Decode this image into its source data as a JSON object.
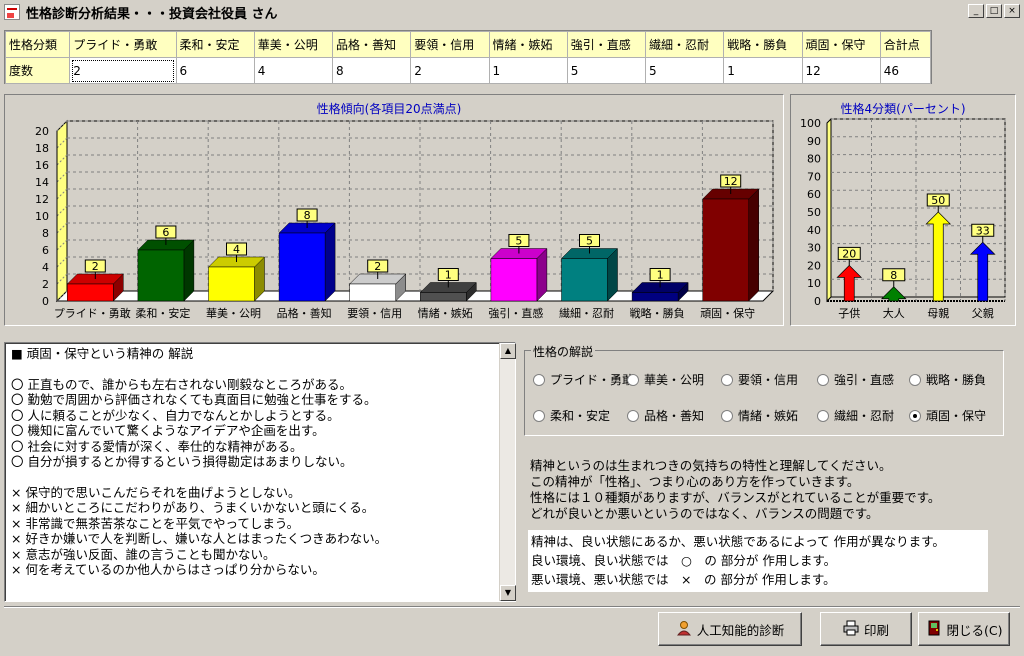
{
  "window": {
    "title": "性格診断分析結果・・・投資会社役員 さん",
    "minimize": "_",
    "maximize": "□",
    "close": "×"
  },
  "table": {
    "row_header": "性格分類",
    "headers": [
      "プライド・勇敢",
      "柔和・安定",
      "華美・公明",
      "品格・善知",
      "要領・信用",
      "情緒・嫉妬",
      "強引・直感",
      "繊細・忍耐",
      "戦略・勝負",
      "頑固・保守",
      "合計点"
    ],
    "value_label": "度数",
    "values": [
      "2",
      "6",
      "4",
      "8",
      "2",
      "1",
      "5",
      "5",
      "1",
      "12",
      "46"
    ]
  },
  "chart_data": [
    {
      "type": "bar",
      "title": "性格傾向(各項目20点満点)",
      "categories": [
        "プライド・勇敢",
        "柔和・安定",
        "華美・公明",
        "品格・善知",
        "要領・信用",
        "情緒・嫉妬",
        "強引・直感",
        "繊細・忍耐",
        "戦略・勝負",
        "頑固・保守"
      ],
      "values": [
        2,
        6,
        4,
        8,
        2,
        1,
        5,
        5,
        1,
        12
      ],
      "colors": [
        "#ff0000",
        "#006400",
        "#ffff00",
        "#0000ff",
        "#ffffff",
        "#505050",
        "#ff00ff",
        "#008080",
        "#000080",
        "#800000"
      ],
      "ylim": [
        0,
        20
      ],
      "yticks": [
        0,
        2,
        4,
        6,
        8,
        10,
        12,
        14,
        16,
        18,
        20
      ],
      "grid": true
    },
    {
      "type": "bar",
      "title": "性格4分類(パーセント)",
      "categories": [
        "子供",
        "大人",
        "母親",
        "父親"
      ],
      "values": [
        20,
        8,
        50,
        33
      ],
      "colors": [
        "#ff0000",
        "#008000",
        "#ffff00",
        "#0000ff"
      ],
      "ylim": [
        0,
        100
      ],
      "yticks": [
        0,
        10,
        20,
        30,
        40,
        50,
        60,
        70,
        80,
        90,
        100
      ],
      "grid": true
    }
  ],
  "explanation": {
    "heading": "■ 頑固・保守という精神の 解説",
    "good_lines": [
      "〇 正直もので、誰からも左右されない剛毅なところがある。",
      "〇 勤勉で周囲から評価されなくても真面目に勉強と仕事をする。",
      "〇 人に頼ることが少なく、自力でなんとかしようとする。",
      "〇 機知に富んでいて驚くようなアイデアや企画を出す。",
      "〇 社会に対する愛情が深く、奉仕的な精神がある。",
      "〇 自分が損するとか得するという損得勘定はあまりしない。"
    ],
    "bad_lines": [
      "× 保守的で思いこんだらそれを曲げようとしない。",
      "× 細かいところにこだわりがあり、うまくいかないと頭にくる。",
      "× 非常識で無茶苦茶なことを平気でやってしまう。",
      "× 好きか嫌いで人を判断し、嫌いな人とはまったくつきあわない。",
      "× 意志が強い反面、誰の言うことも聞かない。",
      "× 何を考えているのか他人からはさっぱり分からない。"
    ]
  },
  "radio_group": {
    "legend": "性格の解説",
    "options": [
      "プライド・勇敢",
      "華美・公明",
      "要領・信用",
      "強引・直感",
      "戦略・勝負",
      "柔和・安定",
      "品格・善知",
      "情緒・嫉妬",
      "繊細・忍耐",
      "頑固・保守"
    ],
    "selected": "頑固・保守"
  },
  "notes": [
    "精神というのは生まれつきの気持ちの特性と理解してください。",
    "この精神が「性格」、つまり心のあり方を作っていきます。",
    "性格には１０種類がありますが、バランスがとれていることが重要です。",
    "どれが良いとか悪いというのではなく、バランスの問題です。"
  ],
  "state_notes": [
    "精神は、良い状態にあるか、悪い状態であるによって 作用が異なります。",
    "良い環境、良い状態では　○　の 部分が 作用します。",
    "悪い環境、悪い状態では　×　の 部分が 作用します。"
  ],
  "buttons": {
    "ai": "人工知能的診断",
    "print": "印刷",
    "close": "閉じる(C)"
  }
}
